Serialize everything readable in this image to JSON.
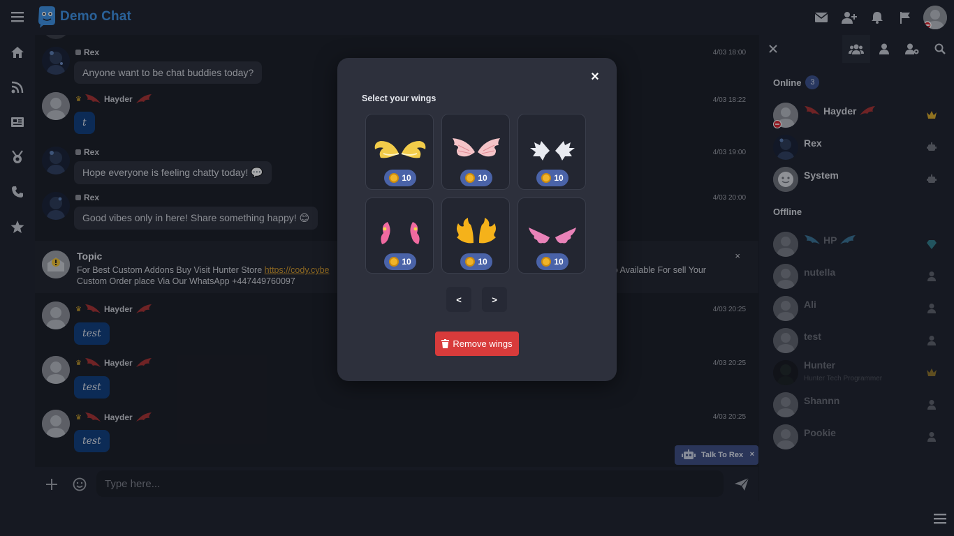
{
  "app": {
    "title": "Demo Chat"
  },
  "chat": {
    "messages": [
      {
        "user": "Rex",
        "time": "4/03 18:00",
        "text": "Anyone want to be chat buddies today?"
      },
      {
        "user": "Hayder",
        "time": "4/03 18:22",
        "text": "t"
      },
      {
        "user": "Rex",
        "time": "4/03 19:00",
        "text": "Hope everyone is feeling chatty today! 💬"
      },
      {
        "user": "Rex",
        "time": "4/03 20:00",
        "text": "Good vibes only in here! Share something happy! 😊"
      },
      {
        "user": "Hayder",
        "time": "4/03 20:25",
        "text": "test"
      },
      {
        "user": "Hayder",
        "time": "4/03 20:25",
        "text": "test"
      },
      {
        "user": "Hayder",
        "time": "4/03 20:25",
        "text": "test"
      }
    ],
    "topic": {
      "title": "Topic",
      "text_before": "For Best Custom Addons Buy Visit Hunter Store ",
      "link": "https://cody.cybe",
      "text_after": "so Available For sell Your",
      "line2": "Custom Order place Via Our WhatsApp +447449760097",
      "close": "×"
    },
    "input_placeholder": "Type here...",
    "talk_button": "Talk To Rex",
    "talk_close": "×"
  },
  "modal": {
    "title": "Select your wings",
    "close": "×",
    "wings": [
      {
        "price": "10",
        "color": "#f2cc4a"
      },
      {
        "price": "10",
        "color": "#f5c4c8"
      },
      {
        "price": "10",
        "color": "#e8eaf0"
      },
      {
        "price": "10",
        "color": "#f06aa0"
      },
      {
        "price": "10",
        "color": "#f5b21a"
      },
      {
        "price": "10",
        "color": "#e982b8"
      }
    ],
    "prev": "<",
    "next": ">",
    "remove": "Remove wings"
  },
  "panel": {
    "online_label": "Online",
    "online_count": "3",
    "offline_label": "Offline",
    "online": [
      {
        "name": "Hayder",
        "rank": "crown"
      },
      {
        "name": "Rex",
        "rank": "bot"
      },
      {
        "name": "System",
        "rank": "bot"
      }
    ],
    "offline": [
      {
        "name": "HP",
        "rank": "diamond",
        "mood": ""
      },
      {
        "name": "nutella",
        "rank": "user",
        "mood": ""
      },
      {
        "name": "Ali",
        "rank": "user",
        "mood": ""
      },
      {
        "name": "test",
        "rank": "user",
        "mood": ""
      },
      {
        "name": "Hunter",
        "rank": "crown",
        "mood": "Hunter Tech Programmer"
      },
      {
        "name": "Shannn",
        "rank": "user",
        "mood": ""
      },
      {
        "name": "Pookie",
        "rank": "user",
        "mood": ""
      }
    ]
  },
  "colors": {
    "accent": "#3d8fe0",
    "danger": "#d83b3b",
    "badge": "#4a63a8"
  }
}
